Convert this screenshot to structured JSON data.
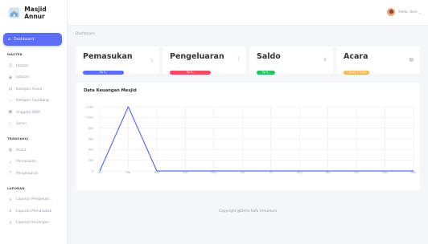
{
  "brand": {
    "title": "Masjid Annur"
  },
  "sidebar": {
    "active": {
      "label": "Dashboard",
      "icon": "dashboard-icon"
    },
    "master_title": "MASTER",
    "master": [
      {
        "label": "Ustadz",
        "icon": "user-icon"
      },
      {
        "label": "Jabatan",
        "icon": "briefcase-icon"
      },
      {
        "label": "Kategori Acara",
        "icon": "list-icon"
      },
      {
        "label": "Kategori Sumbang...",
        "icon": "card-icon"
      },
      {
        "label": "Anggota DKM",
        "icon": "users-icon"
      },
      {
        "label": "Saran",
        "icon": "chat-icon"
      }
    ],
    "transaksi_title": "TRANSAKSI",
    "transaksi": [
      {
        "label": "Acara",
        "icon": "calendar-icon"
      },
      {
        "label": "Pemasukan",
        "icon": "download-icon"
      },
      {
        "label": "Pengeluaran",
        "icon": "upload-icon"
      }
    ],
    "laporan_title": "LAPORAN",
    "laporan": [
      {
        "label": "Laporan Pengeluar...",
        "icon": "dollar-icon"
      },
      {
        "label": "Laporan Pemasukan",
        "icon": "dollar-icon"
      },
      {
        "label": "Laporan Keuangan",
        "icon": "dollar-icon"
      }
    ]
  },
  "topbar": {
    "user_name": "Hello, dela"
  },
  "breadcrumb": "Dashboard",
  "cards": [
    {
      "title": "Pemasukan",
      "badge": "Rp 0,-",
      "color": "#5b6ef5",
      "icon": "download-icon"
    },
    {
      "title": "Pengeluaran",
      "badge": "Rp 0,-",
      "color": "#ef4d63",
      "icon": "upload-icon"
    },
    {
      "title": "Saldo",
      "badge": "Rp 0,-",
      "color": "#22c55e",
      "icon": "dollar-icon"
    },
    {
      "title": "Acara",
      "badge": "0 Acara 1 Bulan",
      "color": "#f7b84b",
      "icon": "calendar-icon"
    }
  ],
  "chart_data": {
    "type": "line",
    "title": "Data Keuangan Mesjid",
    "categories": [
      "Jan",
      "Feb",
      "Mar",
      "Apr",
      "May",
      "Jun",
      "Jul",
      "Aug",
      "Sep",
      "Oct",
      "Nov",
      "Dec"
    ],
    "y_ticks": [
      "0",
      "20k",
      "40k",
      "60k",
      "80k",
      "100k",
      "120k"
    ],
    "ylim": [
      0,
      120000
    ],
    "series": [
      {
        "values": [
          0,
          120000,
          0,
          0,
          0,
          0,
          0,
          0,
          0,
          0,
          0,
          0
        ],
        "color": "#5b6ef5"
      }
    ],
    "grid": true,
    "legend": "none"
  },
  "footer": "Copyright @Della Sofa Irmumuni"
}
